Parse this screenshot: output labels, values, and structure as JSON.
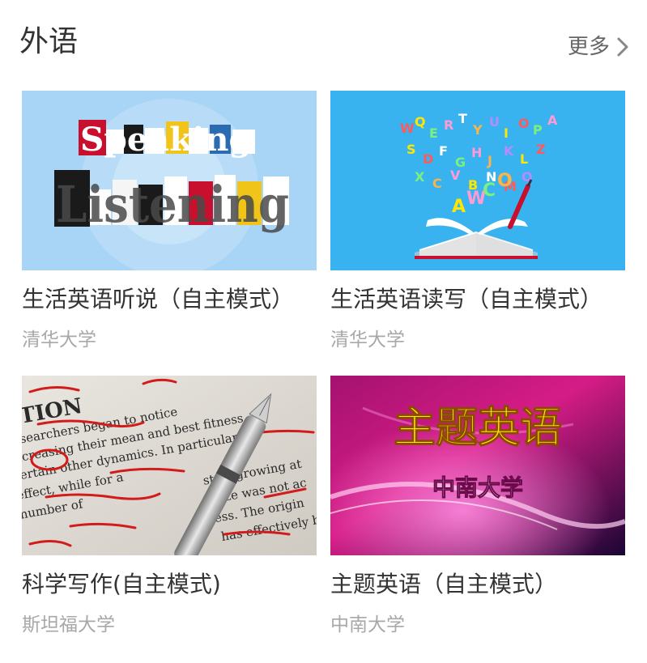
{
  "section": {
    "title": "外语",
    "more_label": "更多",
    "more_icon": "chevron-right-icon"
  },
  "courses": [
    {
      "title": "生活英语听说（自主模式）",
      "school": "清华大学",
      "thumb_text_1": "Speaking",
      "thumb_text_2": "Listening"
    },
    {
      "title": "生活英语读写（自主模式）",
      "school": "清华大学"
    },
    {
      "title": "科学写作(自主模式)",
      "school": "斯坦福大学",
      "thumb_lines": [
        "CTION",
        "researchers began to notice",
        "increasing their mean and best fitness",
        "certain other dynamics. In particular",
        "effect, while for a",
        "start growing at",
        "number of",
        "size was not ac",
        "fitness. The origin",
        "has effectively bee"
      ]
    },
    {
      "title": "主题英语（自主模式）",
      "school": "中南大学",
      "thumb_title": "主题英语",
      "thumb_subtitle": "中南大学"
    }
  ],
  "colors": {
    "title_text": "#333333",
    "school_text": "#a8a8a8",
    "more_text": "#666666",
    "thumb_sky": "#a8d4f5",
    "thumb_blue": "#39b3f0",
    "thumb_magenta": "#c0137e",
    "thumb_yellow": "#ffe600"
  }
}
